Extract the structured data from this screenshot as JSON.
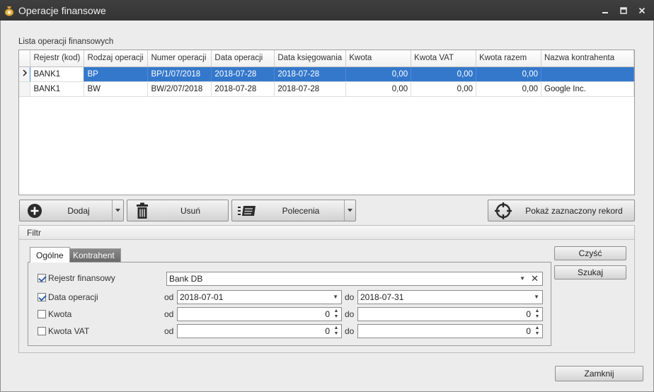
{
  "window": {
    "title": "Operacje finansowe"
  },
  "list": {
    "label": "Lista operacji finansowych",
    "columns": [
      "Rejestr (kod)",
      "Rodzaj operacji",
      "Numer operacji",
      "Data operacji",
      "Data księgowania",
      "Kwota",
      "Kwota VAT",
      "Kwota razem",
      "Nazwa kontrahenta"
    ],
    "rows": [
      [
        "BANK1",
        "BP",
        "BP/1/07/2018",
        "2018-07-28",
        "2018-07-28",
        "0,00",
        "0,00",
        "0,00",
        ""
      ],
      [
        "BANK1",
        "BW",
        "BW/2/07/2018",
        "2018-07-28",
        "2018-07-28",
        "0,00",
        "0,00",
        "0,00",
        "Google Inc."
      ]
    ]
  },
  "toolbar": {
    "add_label": "Dodaj",
    "delete_label": "Usuń",
    "commands_label": "Polecenia",
    "show_selected_label": "Pokaż zaznaczony rekord"
  },
  "filter": {
    "title": "Filtr",
    "tabs": [
      "Ogólne",
      "Kontrahent"
    ],
    "register": {
      "label": "Rejestr finansowy",
      "checked": true,
      "value": "Bank DB"
    },
    "op_date": {
      "label": "Data operacji",
      "checked": true,
      "from_label": "od",
      "from": "2018-07-01",
      "to_label": "do",
      "to": "2018-07-31"
    },
    "amount": {
      "label": "Kwota",
      "checked": false,
      "from_label": "od",
      "from": "0",
      "to_label": "do",
      "to": "0"
    },
    "vat": {
      "label": "Kwota VAT",
      "checked": false,
      "from_label": "od",
      "from": "0",
      "to_label": "do",
      "to": "0"
    },
    "clear_label": "Czyść",
    "search_label": "Szukaj"
  },
  "footer": {
    "close_label": "Zamknij"
  },
  "colors": {
    "selection": "#3478cc",
    "titlebar": "#3a3a3a"
  }
}
